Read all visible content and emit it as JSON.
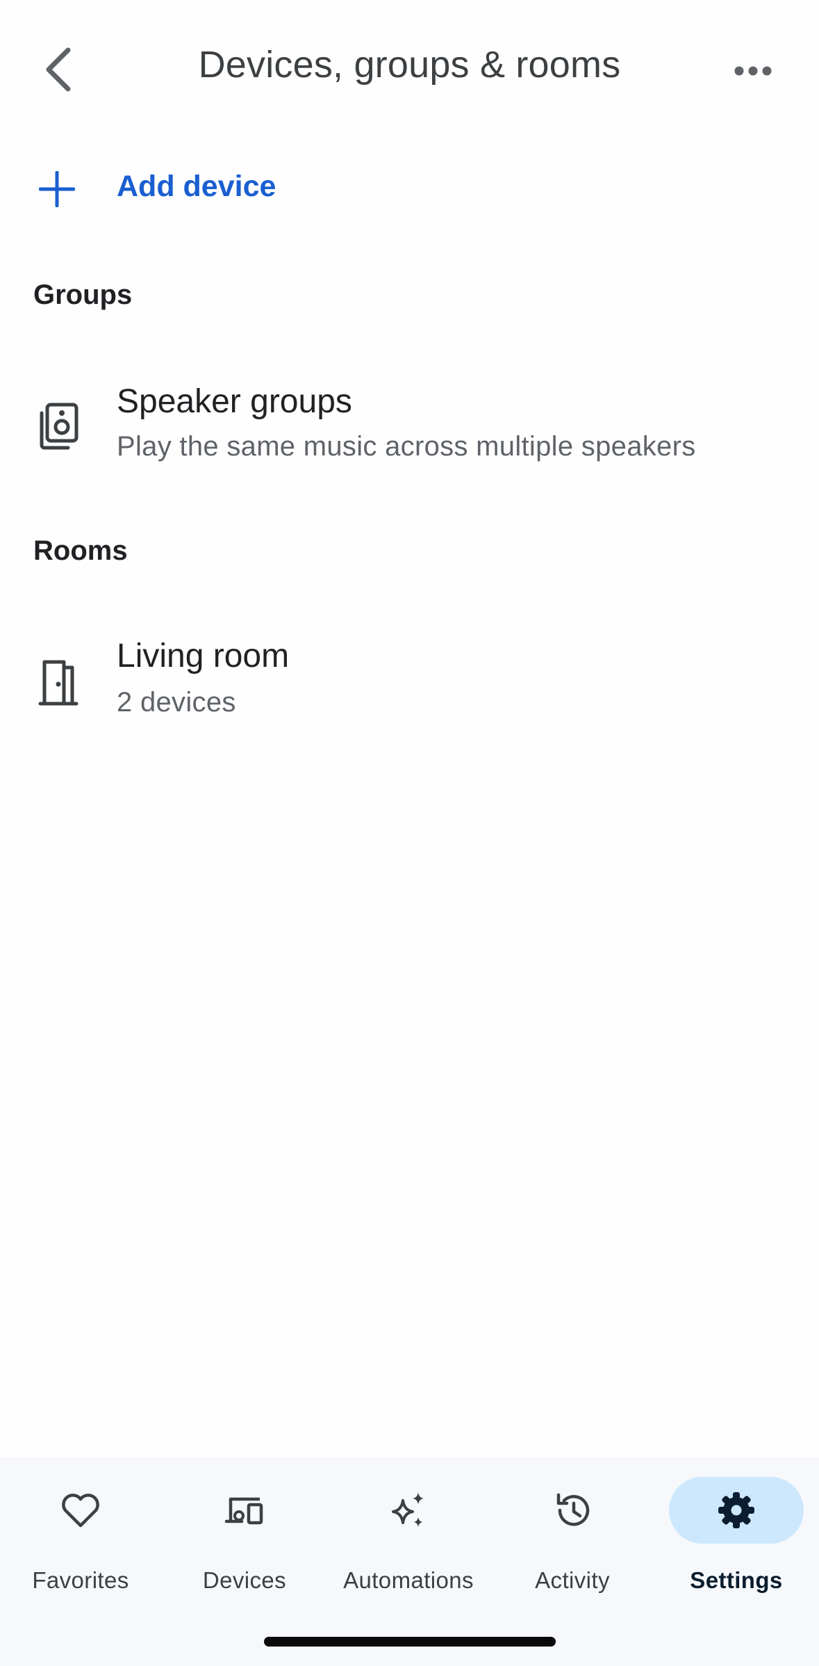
{
  "header": {
    "title": "Devices, groups & rooms",
    "back_icon": "chevron-left-icon",
    "more_icon": "more-horizontal-icon"
  },
  "add_device": {
    "label": "Add device",
    "icon": "plus-icon",
    "color": "#1a5fd1"
  },
  "groups": {
    "header": "Groups",
    "items": [
      {
        "title": "Speaker groups",
        "subtitle": "Play the same music across multiple speakers",
        "icon": "speaker-group-icon"
      }
    ]
  },
  "rooms": {
    "header": "Rooms",
    "items": [
      {
        "title": "Living room",
        "subtitle": "2 devices",
        "icon": "door-icon"
      }
    ]
  },
  "bottom_nav": {
    "items": [
      {
        "label": "Favorites",
        "icon": "heart-icon",
        "active": false
      },
      {
        "label": "Devices",
        "icon": "devices-icon",
        "active": false
      },
      {
        "label": "Automations",
        "icon": "sparkle-icon",
        "active": false
      },
      {
        "label": "Activity",
        "icon": "history-icon",
        "active": false
      },
      {
        "label": "Settings",
        "icon": "gear-icon",
        "active": true
      }
    ],
    "active_color": "#cde8fd"
  }
}
